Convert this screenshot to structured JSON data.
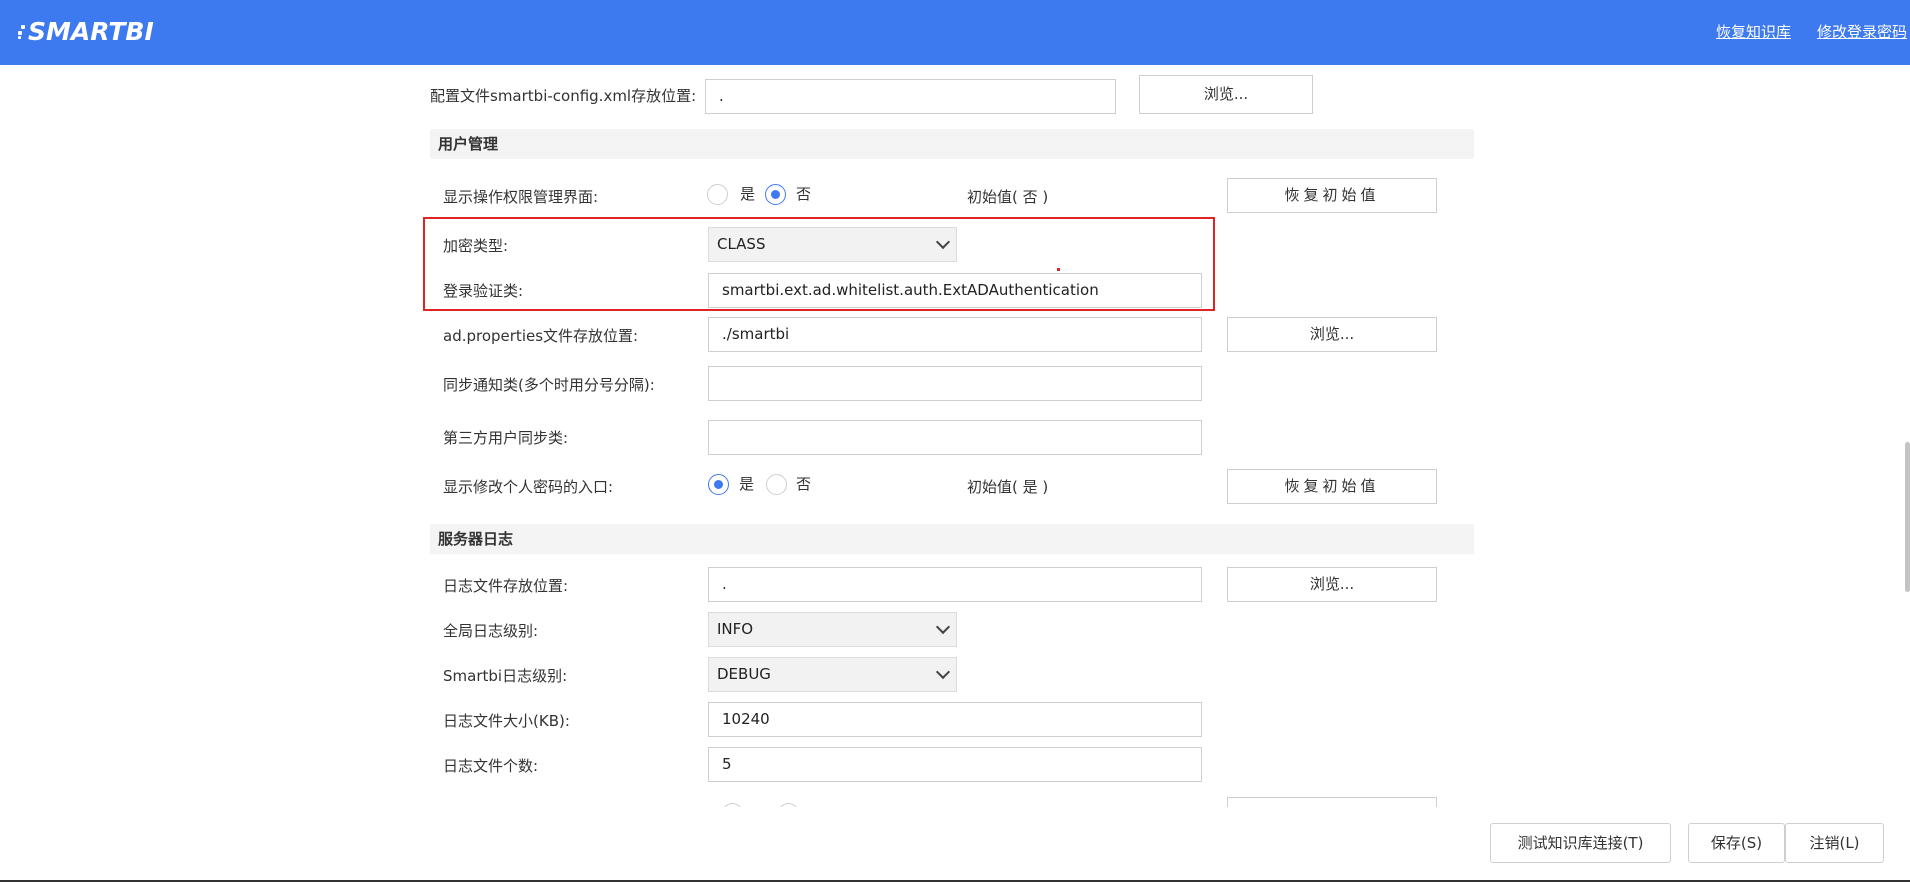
{
  "header": {
    "logo_text": "SMARTBI",
    "links": [
      "恢复知识库",
      "修改登录密码"
    ]
  },
  "config": {
    "path_label": "配置文件smartbi-config.xml存放位置:",
    "path_value": ".",
    "browse_label": "浏览..."
  },
  "user_mgmt": {
    "title": "用户管理",
    "show_perm": {
      "label": "显示操作权限管理界面:",
      "opt_yes": "是",
      "opt_no": "否",
      "selected": "否",
      "initial": "初始值( 否 )",
      "reset_label": "恢复初始值"
    },
    "encrypt": {
      "label": "加密类型:",
      "value": "CLASS"
    },
    "login_class": {
      "label": "登录验证类:",
      "value": "smartbi.ext.ad.whitelist.auth.ExtADAuthentication"
    },
    "ad_props": {
      "label": "ad.properties文件存放位置:",
      "value": "./smartbi",
      "browse_label": "浏览..."
    },
    "sync_notify": {
      "label": "同步通知类(多个时用分号分隔):",
      "value": ""
    },
    "third_sync": {
      "label": "第三方用户同步类:",
      "value": ""
    },
    "show_pwd": {
      "label": "显示修改个人密码的入口:",
      "opt_yes": "是",
      "opt_no": "否",
      "selected": "是",
      "initial": "初始值( 是 )",
      "reset_label": "恢复初始值"
    }
  },
  "server_log": {
    "title": "服务器日志",
    "log_path": {
      "label": "日志文件存放位置:",
      "value": ".",
      "browse_label": "浏览..."
    },
    "global_level": {
      "label": "全局日志级别:",
      "value": "INFO"
    },
    "smartbi_level": {
      "label": "Smartbi日志级别:",
      "value": "DEBUG"
    },
    "file_size": {
      "label": "日志文件大小(KB):",
      "value": "10240"
    },
    "file_count": {
      "label": "日志文件个数:",
      "value": "5"
    }
  },
  "footer": {
    "test_label": "测试知识库连接(T)",
    "save_label": "保存(S)",
    "logout_label": "注销(L)"
  },
  "colors": {
    "accent": "#3d7af0",
    "highlight_border": "#e02424"
  }
}
